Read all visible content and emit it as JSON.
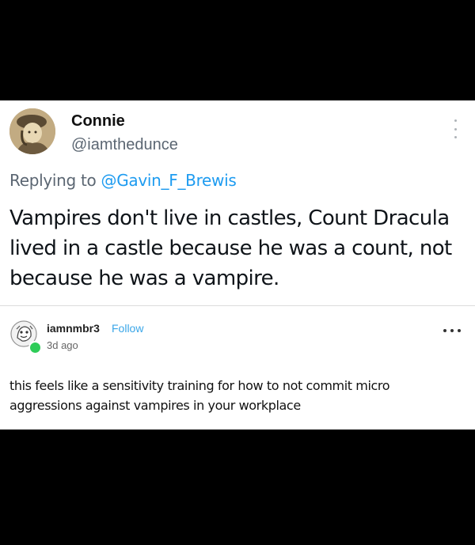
{
  "tweet": {
    "avatar_icon": "portrait-avatar-icon",
    "display_name": "Connie",
    "handle": "@iamthedunce",
    "replying_prefix": "Replying to ",
    "replying_to": "@Gavin_F_Brewis",
    "text": "Vampires don't live in castles, Count Dracula lived in a castle because he was a count, not because he was a vampire.",
    "more_icon": "vertical-ellipsis-icon"
  },
  "comment": {
    "avatar_icon": "cartoon-avatar-icon",
    "username": "iamnmbr3",
    "follow_label": "Follow",
    "time": "3d ago",
    "text": "this feels like a sensitivity training for how to not commit micro aggressions against vampires in your workplace",
    "more_icon": "horizontal-ellipsis-icon"
  },
  "colors": {
    "mention": "#1d9bf0",
    "follow": "#3aa6e8",
    "online": "#2ecc58",
    "background": "#000000"
  }
}
